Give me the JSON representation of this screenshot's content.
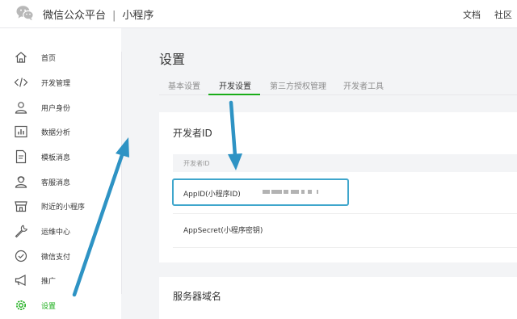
{
  "header": {
    "brand": "微信公众平台",
    "separator": "|",
    "product": "小程序",
    "links": [
      "文档",
      "社区"
    ]
  },
  "sidebar": {
    "items": [
      {
        "label": "首页",
        "icon": "home-icon"
      },
      {
        "label": "开发管理",
        "icon": "code-icon"
      },
      {
        "label": "用户身份",
        "icon": "user-icon"
      },
      {
        "label": "数据分析",
        "icon": "chart-icon"
      },
      {
        "label": "模板消息",
        "icon": "document-icon"
      },
      {
        "label": "客服消息",
        "icon": "customer-service-icon"
      },
      {
        "label": "附近的小程序",
        "icon": "store-icon"
      },
      {
        "label": "运维中心",
        "icon": "wrench-icon"
      },
      {
        "label": "微信支付",
        "icon": "payment-icon"
      },
      {
        "label": "推广",
        "icon": "megaphone-icon"
      },
      {
        "label": "设置",
        "icon": "gear-icon",
        "active": true
      }
    ]
  },
  "main": {
    "title": "设置",
    "tabs": [
      {
        "label": "基本设置"
      },
      {
        "label": "开发设置",
        "active": true
      },
      {
        "label": "第三方授权管理"
      },
      {
        "label": "开发者工具"
      }
    ],
    "developer_id": {
      "title": "开发者ID",
      "column_header": "开发者ID",
      "rows": [
        {
          "label": "AppID(小程序ID)"
        },
        {
          "label": "AppSecret(小程序密钥)"
        }
      ]
    },
    "server_domain": {
      "title": "服务器域名"
    }
  },
  "colors": {
    "accent_green": "#1aad19",
    "highlight_blue": "#3fa6cc",
    "arrow_blue": "#2e93c4"
  }
}
